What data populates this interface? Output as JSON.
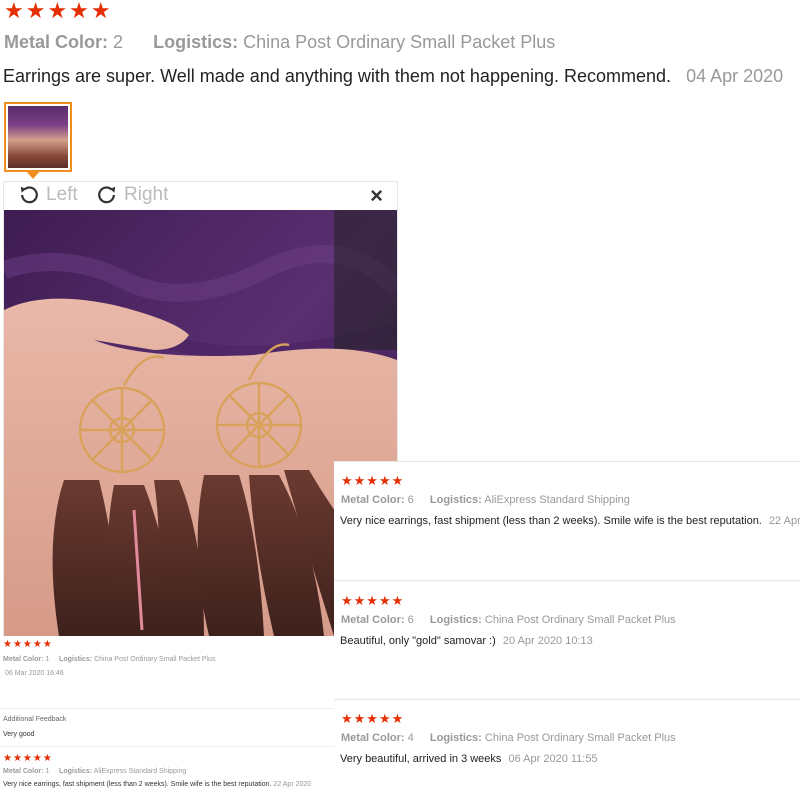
{
  "top_review": {
    "stars": "★★★★★",
    "metal_label": "Metal Color:",
    "metal_value": "2",
    "logistics_label": "Logistics:",
    "logistics_value": "China Post Ordinary Small Packet Plus",
    "text": "Earrings are super. Well made and anything with them not happening. Recommend.",
    "date": "04 Apr 2020"
  },
  "viewer": {
    "rotate_left_label": "Left",
    "rotate_right_label": "Right",
    "close_glyph": "×"
  },
  "left_reviews": {
    "first": {
      "stars": "★★★★★",
      "metal_label": "Metal Color:",
      "metal_value": "1",
      "logistics_label": "Logistics:",
      "logistics_value": "China Post Ordinary Small Packet Plus",
      "date": "06 Mar 2020 16:46"
    },
    "additional_feedback": {
      "title": "Additional Feedback",
      "text": "Very good"
    },
    "second": {
      "stars": "★★★★★",
      "metal_label": "Metal Color:",
      "metal_value": "1",
      "logistics_label": "Logistics:",
      "logistics_value": "AliExpress Standard Shipping",
      "text": "Very nice earrings, fast shipment (less than 2 weeks). Smile wife is the best reputation.",
      "date": "22 Apr 2020"
    }
  },
  "right_reviews": [
    {
      "stars": "★★★★★",
      "metal_label": "Metal Color:",
      "metal_value": "6",
      "logistics_label": "Logistics:",
      "logistics_value": "AliExpress Standard Shipping",
      "text": "Very nice earrings, fast shipment (less than 2 weeks). Smile wife is the best reputation.",
      "date": "22 Apr"
    },
    {
      "stars": "★★★★★",
      "metal_label": "Metal Color:",
      "metal_value": "6",
      "logistics_label": "Logistics:",
      "logistics_value": "China Post Ordinary Small Packet Plus",
      "text": "Beautiful, only \"gold\" samovar :)",
      "date": "20 Apr 2020 10:13"
    },
    {
      "stars": "★★★★★",
      "metal_label": "Metal Color:",
      "metal_value": "4",
      "logistics_label": "Logistics:",
      "logistics_value": "China Post Ordinary Small Packet Plus",
      "text": "Very beautiful, arrived in 3 weeks",
      "date": "06 Apr 2020 11:55"
    }
  ],
  "colors": {
    "star": "#e62e04",
    "thumb_border": "#f08d1e",
    "muted_text": "#999999"
  }
}
